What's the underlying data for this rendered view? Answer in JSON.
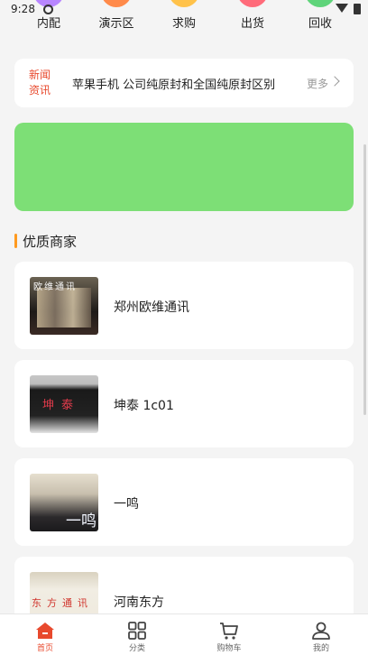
{
  "status": {
    "time": "9:28"
  },
  "categories": [
    {
      "label": "内配",
      "color": "#b886ff"
    },
    {
      "label": "演示区",
      "color": "#ff8a4a"
    },
    {
      "label": "求购",
      "color": "#ffc24a"
    },
    {
      "label": "出货",
      "color": "#ff6b7a"
    },
    {
      "label": "回收",
      "color": "#5fd47a"
    }
  ],
  "news": {
    "tag": "新闻资讯",
    "headline": "苹果手机 公司纯原封和全国纯原封区别",
    "more": "更多"
  },
  "banner": {
    "color": "#7ddf76"
  },
  "section": {
    "title": "优质商家"
  },
  "merchants": [
    {
      "name": "郑州欧维通讯",
      "thumb_text": "欧维通讯"
    },
    {
      "name": "坤泰 1c01",
      "thumb_text": "坤泰"
    },
    {
      "name": "一鸣",
      "thumb_text": "一鸣"
    },
    {
      "name": "河南东方",
      "thumb_text": "东方通讯"
    }
  ],
  "nav": [
    {
      "label": "首页",
      "icon": "home-icon",
      "active": true
    },
    {
      "label": "分类",
      "icon": "grid-icon",
      "active": false
    },
    {
      "label": "购物车",
      "icon": "cart-icon",
      "active": false
    },
    {
      "label": "我的",
      "icon": "user-icon",
      "active": false
    }
  ],
  "colors": {
    "accent": "#e8492d",
    "section_bar": "#ff9a1f"
  }
}
